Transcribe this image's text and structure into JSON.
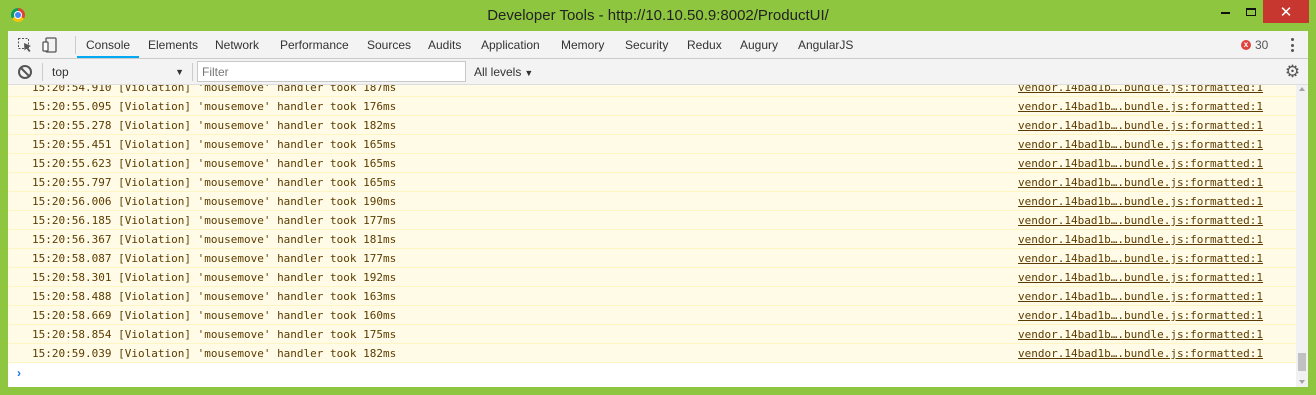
{
  "window": {
    "title": "Developer Tools - http://10.10.50.9:8002/ProductUI/",
    "minimize_icon": "minimize-icon",
    "maximize_icon": "maximize-icon",
    "close_glyph": "✕"
  },
  "tabs": [
    {
      "label": "Console",
      "active": true
    },
    {
      "label": "Elements"
    },
    {
      "label": "Network"
    },
    {
      "label": "Performance"
    },
    {
      "label": "Sources"
    },
    {
      "label": "Audits"
    },
    {
      "label": "Application"
    },
    {
      "label": "Memory"
    },
    {
      "label": "Security"
    },
    {
      "label": "Redux"
    },
    {
      "label": "Augury"
    },
    {
      "label": "AngularJS"
    }
  ],
  "errors": {
    "count": "30",
    "glyph": "x"
  },
  "filterbar": {
    "context": "top",
    "filter_placeholder": "Filter",
    "levels": "All levels",
    "caret": "▼",
    "gear_glyph": "⚙"
  },
  "logs": [
    {
      "time": "15:20:54.910",
      "ms": "187ms"
    },
    {
      "time": "15:20:55.095",
      "ms": "176ms"
    },
    {
      "time": "15:20:55.278",
      "ms": "182ms"
    },
    {
      "time": "15:20:55.451",
      "ms": "165ms"
    },
    {
      "time": "15:20:55.623",
      "ms": "165ms"
    },
    {
      "time": "15:20:55.797",
      "ms": "165ms"
    },
    {
      "time": "15:20:56.006",
      "ms": "190ms"
    },
    {
      "time": "15:20:56.185",
      "ms": "177ms"
    },
    {
      "time": "15:20:56.367",
      "ms": "181ms"
    },
    {
      "time": "15:20:58.087",
      "ms": "177ms"
    },
    {
      "time": "15:20:58.301",
      "ms": "192ms"
    },
    {
      "time": "15:20:58.488",
      "ms": "163ms"
    },
    {
      "time": "15:20:58.669",
      "ms": "160ms"
    },
    {
      "time": "15:20:58.854",
      "ms": "175ms"
    },
    {
      "time": "15:20:59.039",
      "ms": "182ms"
    }
  ],
  "log_text": {
    "level": "[Violation]",
    "message": "'mousemove' handler took",
    "source": "vendor.14bad1b….bundle.js:formatted:1"
  },
  "prompt_glyph": "›",
  "colors": {
    "window_frame": "#8fc640",
    "close_button": "#c7372f",
    "active_tab_underline": "#03a9f4",
    "warning_row_bg": "#fffbe6",
    "warning_text": "#5c3c00",
    "error_badge": "#e0423c"
  }
}
